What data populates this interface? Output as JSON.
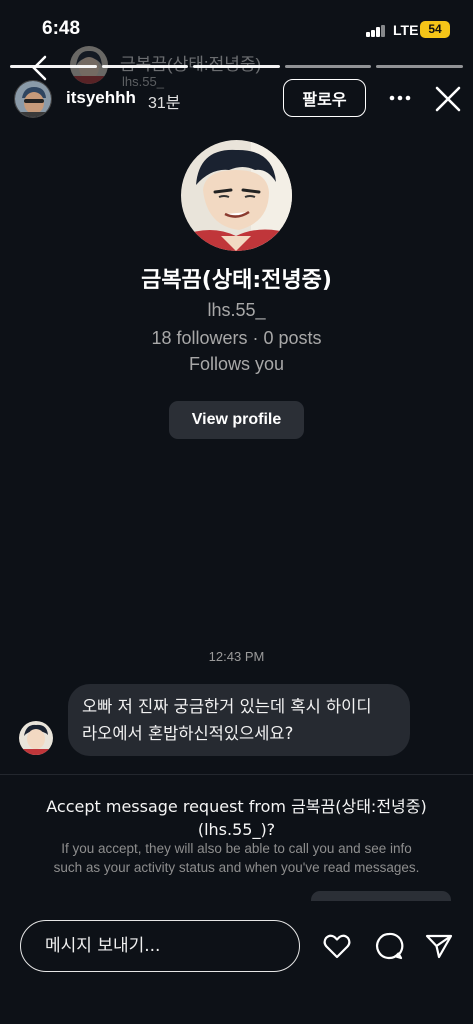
{
  "status_bar": {
    "time": "6:48",
    "network": "LTE",
    "battery": "54"
  },
  "ghost_header": {
    "name": "금복끔(상태:전녕중)",
    "handle": "lhs.55_"
  },
  "story": {
    "username": "itsyehhh",
    "time_ago": "31분",
    "follow_label": "팔로우"
  },
  "profile": {
    "name": "금복끔(상태:전녕중)",
    "handle": "lhs.55_",
    "stats": "18 followers · 0 posts",
    "follows_note": "Follows you",
    "view_profile_label": "View profile"
  },
  "conversation": {
    "timestamp": "12:43 PM",
    "message_line1": "오빠 저 진짜 궁금한거 있는데 혹시 하이디",
    "message_line2": "라오에서 혼밥하신적있으세요?"
  },
  "request": {
    "title_line1": "Accept message request from 금복끔(상태:전녕중)",
    "title_line2": "(lhs.55_)?",
    "description_line1": "If you accept, they will also be able to call you and see info",
    "description_line2": "such as your activity status and when you've read messages."
  },
  "composer": {
    "placeholder": "메시지 보내기..."
  },
  "icons": {
    "heart": "heart-icon",
    "chat": "chat-bubble-icon",
    "send": "send-icon",
    "more": "more-horizontal-icon",
    "close": "close-icon",
    "back": "chevron-left-icon"
  }
}
